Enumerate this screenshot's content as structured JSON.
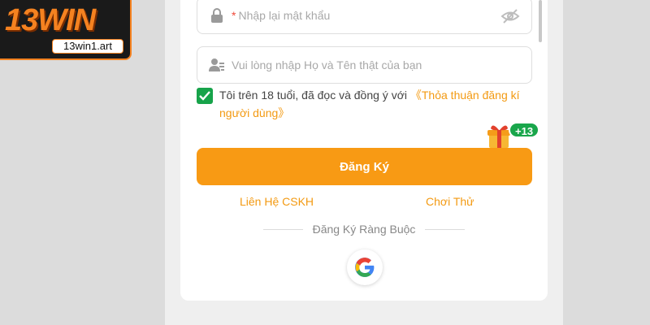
{
  "brand": {
    "logo_text": "13WIN",
    "url": "13win1.art",
    "accent": "#f58220"
  },
  "form": {
    "confirm_password": {
      "required_mark": "*",
      "placeholder": "Nhập lại mật khẩu",
      "icon": "lock-icon",
      "toggle_icon": "eye-off-icon"
    },
    "full_name": {
      "placeholder": "Vui lòng nhập Họ và Tên thật của bạn",
      "icon": "user-card-icon"
    },
    "agreement": {
      "checked": true,
      "text": "Tôi trên 18 tuổi, đã đọc và đồng ý với ",
      "link": "《Thỏa thuận đăng kí người dùng》"
    },
    "bonus_badge": "+13",
    "register_label": "Đăng Ký",
    "register_color": "#f89a14"
  },
  "links": {
    "support": "Liên Hệ CSKH",
    "try_play": "Chơi Thử"
  },
  "social": {
    "divider_label": "Đăng Ký Ràng Buộc",
    "google_icon": "google-icon"
  }
}
